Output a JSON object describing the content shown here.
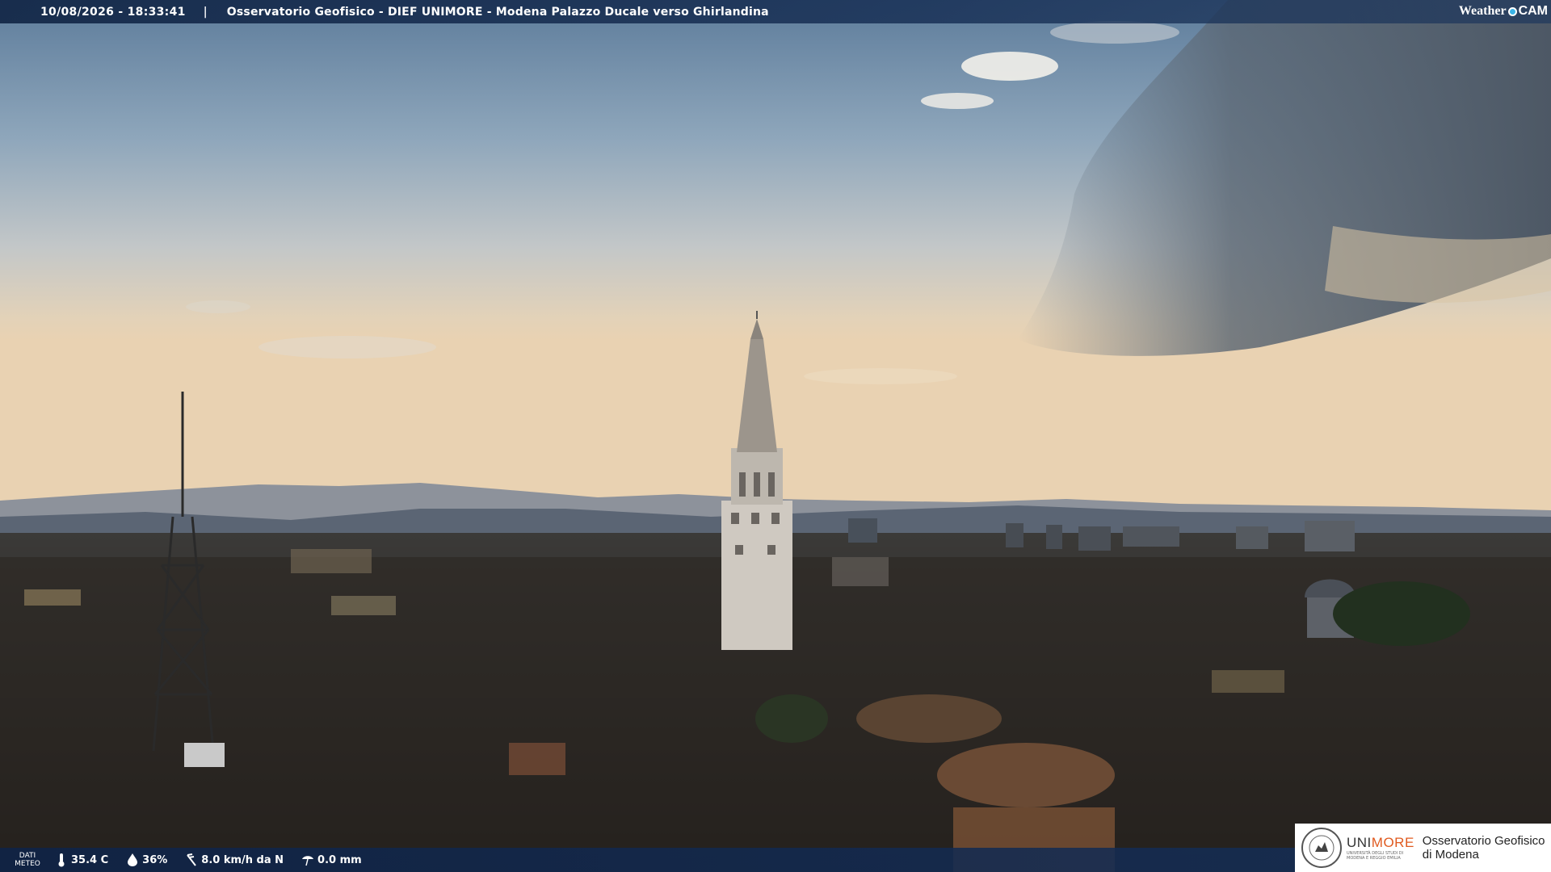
{
  "header": {
    "timestamp": "10/08/2026 - 18:33:41",
    "separator": "|",
    "camera_title": "Osservatorio Geofisico - DIEF UNIMORE - Modena Palazzo Ducale verso Ghirlandina",
    "brand_left": "Weather",
    "brand_right": "CAM"
  },
  "weather": {
    "label_line1": "DATI",
    "label_line2": "METEO",
    "temperature": "35.4 C",
    "humidity": "36%",
    "wind": "8.0 km/h da N",
    "rain": "0.0 mm",
    "icons": [
      "thermometer-icon",
      "humidity-drop-icon",
      "wind-icon",
      "rain-gauge-icon"
    ]
  },
  "institution": {
    "brand_uni": "UNI",
    "brand_more": "MORE",
    "subtitle_line1": "UNIVERSITÀ DEGLI STUDI DI",
    "subtitle_line2": "MODENA E REGGIO EMILIA",
    "name_line1": "Osservatorio Geofisico",
    "name_line2": "di Modena"
  },
  "colors": {
    "overlay_bar": "#183058",
    "accent_orange": "#e05a1f",
    "logo_blue": "#3ab4e8"
  }
}
